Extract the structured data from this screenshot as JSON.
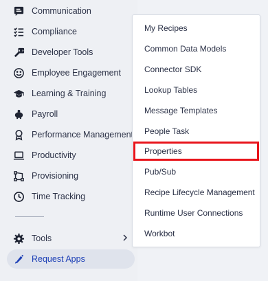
{
  "sidebar": {
    "items": [
      {
        "label": "Communication",
        "icon": "chat-icon"
      },
      {
        "label": "Compliance",
        "icon": "checklist-icon"
      },
      {
        "label": "Developer Tools",
        "icon": "developer-tools-icon"
      },
      {
        "label": "Employee Engagement",
        "icon": "smiley-icon"
      },
      {
        "label": "Learning & Training",
        "icon": "graduation-cap-icon"
      },
      {
        "label": "Payroll",
        "icon": "piggy-bank-icon"
      },
      {
        "label": "Performance Management",
        "icon": "award-icon"
      },
      {
        "label": "Productivity",
        "icon": "laptop-icon"
      },
      {
        "label": "Provisioning",
        "icon": "workflow-icon"
      },
      {
        "label": "Time Tracking",
        "icon": "clock-icon"
      }
    ],
    "tools_label": "Tools",
    "request_apps_label": "Request Apps"
  },
  "dropdown": {
    "items": [
      "My Recipes",
      "Common Data Models",
      "Connector SDK",
      "Lookup Tables",
      "Message Templates",
      "People Task",
      "Properties",
      "Pub/Sub",
      "Recipe Lifecycle Management",
      "Runtime User Connections",
      "Workbot"
    ],
    "highlighted": "Properties"
  },
  "colors": {
    "highlight_border": "#e8141b",
    "active_text": "#1c3fb6",
    "active_background": "#dfe3ec"
  }
}
